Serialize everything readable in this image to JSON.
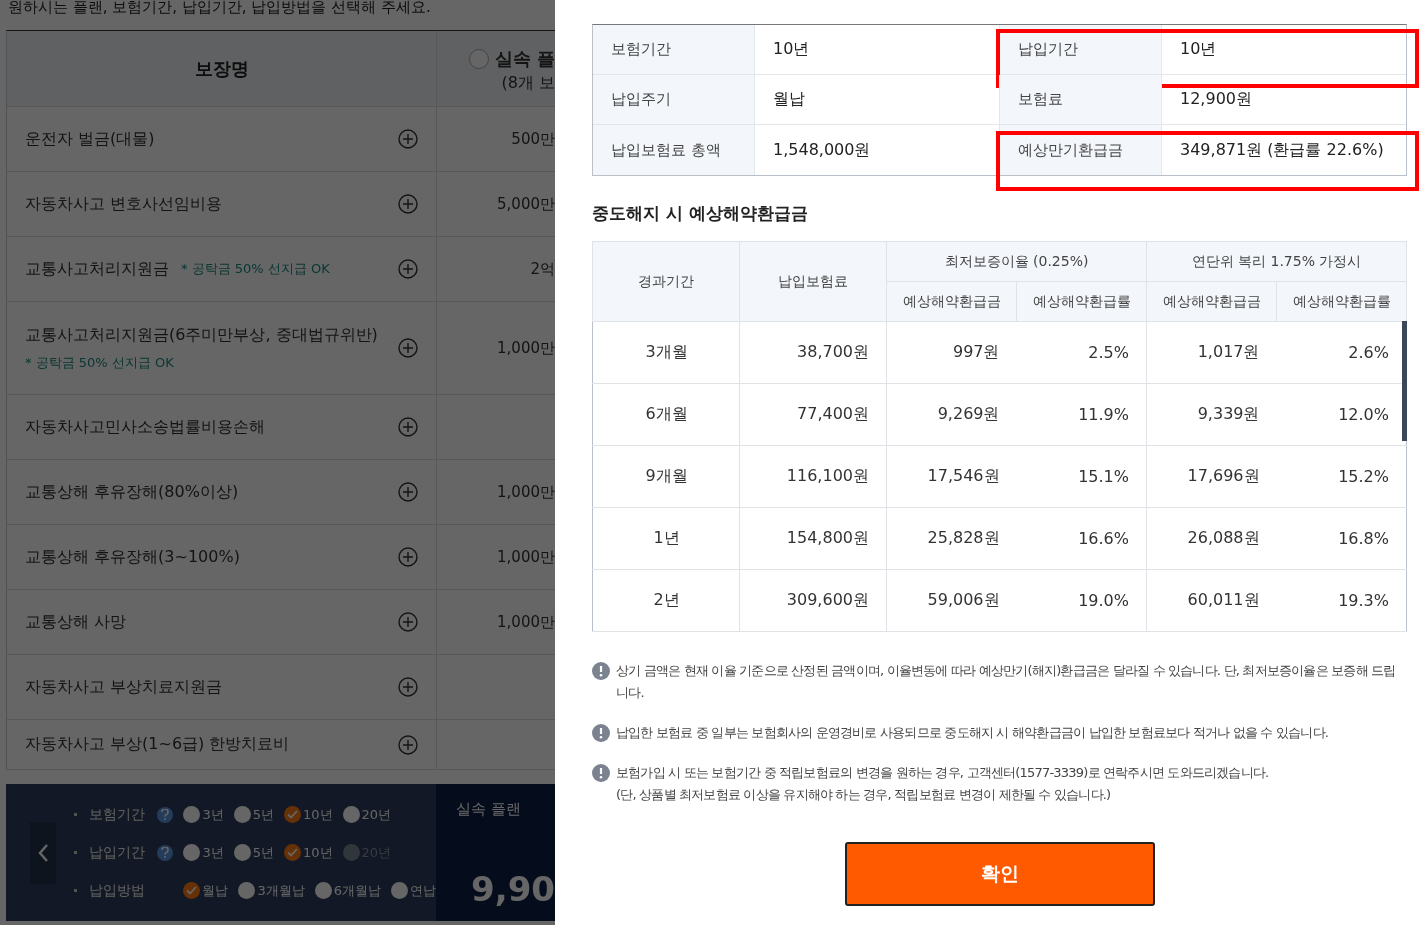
{
  "page": {
    "heading": "원하시는 플랜, 보험기간, 납입기간, 납입방법을 선택해 주세요.",
    "coverage_table": {
      "columns": [
        {
          "label": "보장명"
        },
        {
          "label": "실속 플",
          "sublabel": "(8개 보",
          "selected": false
        }
      ],
      "rows": [
        {
          "name": "운전자 벌금(대물)",
          "amount": "500만"
        },
        {
          "name": "자동차사고 변호사선임비용",
          "amount": "5,000만"
        },
        {
          "name": "교통사고처리지원금",
          "note": "* 공탁금 50% 선지급 OK",
          "note_inline": true,
          "amount": "2억"
        },
        {
          "name": "교통사고처리지원금(6주미만부상, 중대법규위반)",
          "note": "* 공탁금 50% 선지급 OK",
          "note_inline": false,
          "amount": "1,000만"
        },
        {
          "name": "자동차사고민사소송법률비용손해"
        },
        {
          "name": "교통상해 후유장해(80%이상)",
          "amount": "1,000만"
        },
        {
          "name": "교통상해 후유장해(3~100%)",
          "amount": "1,000만"
        },
        {
          "name": "교통상해 사망",
          "amount": "1,000만"
        },
        {
          "name": "자동차사고 부상치료지원금"
        },
        {
          "name": "자동차사고 부상(1~6급) 한방치료비"
        }
      ]
    },
    "options": [
      {
        "label": "보험기간",
        "help": true,
        "choices": [
          {
            "label": "3년",
            "selected": false,
            "disabled": false
          },
          {
            "label": "5년",
            "selected": false,
            "disabled": false
          },
          {
            "label": "10년",
            "selected": true,
            "disabled": false
          },
          {
            "label": "20년",
            "selected": false,
            "disabled": false
          }
        ]
      },
      {
        "label": "납입기간",
        "help": true,
        "choices": [
          {
            "label": "3년",
            "selected": false,
            "disabled": false
          },
          {
            "label": "5년",
            "selected": false,
            "disabled": false
          },
          {
            "label": "10년",
            "selected": true,
            "disabled": false
          },
          {
            "label": "20년",
            "selected": false,
            "disabled": true
          }
        ]
      },
      {
        "label": "납입방법",
        "help": false,
        "choices": [
          {
            "label": "월납",
            "selected": true,
            "disabled": false
          },
          {
            "label": "3개월납",
            "selected": false,
            "disabled": false
          },
          {
            "label": "6개월납",
            "selected": false,
            "disabled": false
          },
          {
            "label": "연납",
            "selected": false,
            "disabled": false
          }
        ]
      }
    ],
    "plan": {
      "title": "실속 플랜",
      "price": "9,90"
    }
  },
  "modal": {
    "summary": [
      [
        {
          "label": "보험기간",
          "value": "10년",
          "highlighted": false
        },
        {
          "label": "납입기간",
          "value": "10년",
          "highlighted": true
        }
      ],
      [
        {
          "label": "납입주기",
          "value": "월납",
          "highlighted": false
        },
        {
          "label": "보험료",
          "value": "12,900원",
          "highlighted": false
        }
      ],
      [
        {
          "label": "납입보험료 총액",
          "value": "1,548,000원",
          "highlighted": false
        },
        {
          "label": "예상만기환급금",
          "value": "349,871원 (환급률 22.6%)",
          "highlighted": true
        }
      ]
    ],
    "refund_title": "중도해지 시 예상해약환급금",
    "refund_table": {
      "headers": [
        "경과기간",
        "납입보험료"
      ],
      "groups": [
        {
          "label": "최저보증이율 (0.25%)",
          "columns": [
            "예상해약환급금",
            "예상해약환급률"
          ]
        },
        {
          "label": "연단위 복리 1.75% 가정시",
          "columns": [
            "예상해약환급금",
            "예상해약환급률"
          ]
        }
      ],
      "rows": [
        [
          "3개월",
          "38,700원",
          "997원",
          "2.5%",
          "1,017원",
          "2.6%"
        ],
        [
          "6개월",
          "77,400원",
          "9,269원",
          "11.9%",
          "9,339원",
          "12.0%"
        ],
        [
          "9개월",
          "116,100원",
          "17,546원",
          "15.1%",
          "17,696원",
          "15.2%"
        ],
        [
          "1년",
          "154,800원",
          "25,828원",
          "16.6%",
          "26,088원",
          "16.8%"
        ],
        [
          "2년",
          "309,600원",
          "59,006원",
          "19.0%",
          "60,011원",
          "19.3%"
        ]
      ]
    },
    "notes": [
      [
        "상기 금액은 현재 이율 기준으로 산정된 금액이며, 이율변동에 따라 예상만기(해지)환급금은 달라질 수 있습니다. 단, 최저보증이율은 보증해 드립니다."
      ],
      [
        "납입한 보험료 중 일부는 보험회사의 운영경비로 사용되므로 중도해지 시 해약환급금이 납입한 보험료보다 적거나 없을 수 있습니다."
      ],
      [
        "보험가입 시 또는 보험기간 중 적립보험료의 변경을 원하는 경우, 고객센터(1577-3339)로 연락주시면 도와드리겠습니다.",
        "(단, 상품별 최저보험료 이상을 유지해야 하는 경우, 적립보험료 변경이 제한될 수 있습니다.)"
      ]
    ],
    "confirm": "확인"
  }
}
